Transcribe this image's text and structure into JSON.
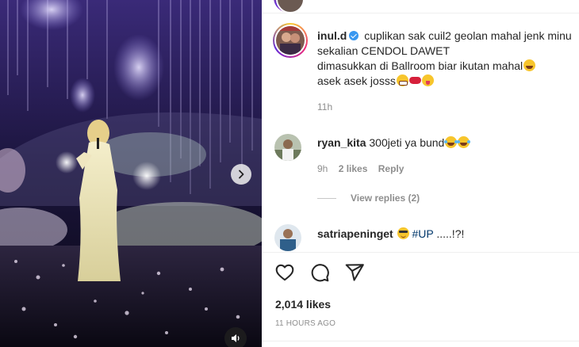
{
  "post": {
    "author": "inul.d",
    "caption_lines": [
      "cuplikan sak cuil2 geolan mahal jenk minu",
      "sekalian CENDOL DAWET",
      "dimasukkan di Ballroom biar ikutan mahal",
      "asek asek josss"
    ],
    "caption_time": "11h",
    "likes": "2,014 likes",
    "posted": "11 HOURS AGO"
  },
  "comments": [
    {
      "user": "ryan_kita",
      "text": "300jeti ya bund",
      "time": "9h",
      "likes": "2 likes",
      "reply": "Reply",
      "view_replies": "View replies (2)"
    },
    {
      "user": "satriapeninget",
      "hashtag": "#UP",
      "text_after": " .....!?!"
    }
  ],
  "icons": {
    "like": "heart-icon",
    "comment": "comment-icon",
    "share": "share-icon",
    "next": "chevron-right-icon",
    "sound": "speaker-icon",
    "verified": "verified-badge-icon"
  },
  "colors": {
    "link": "#00376b",
    "secondary": "#8e8e8e",
    "verified": "#3897f0"
  }
}
